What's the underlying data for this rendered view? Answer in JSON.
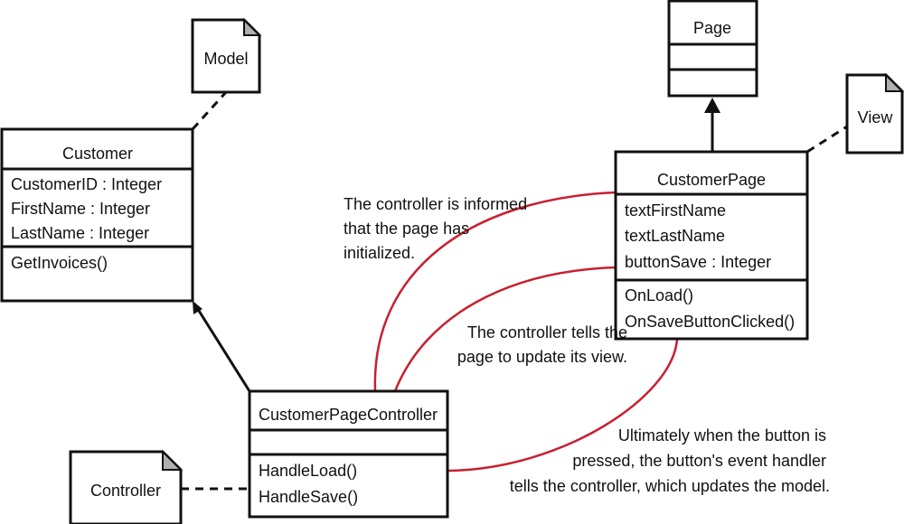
{
  "colors": {
    "association": "#c8202f",
    "note_fold": "#b0b0b0",
    "line": "#111111"
  },
  "notes": {
    "model": "Model",
    "view": "View",
    "controller": "Controller"
  },
  "classes": {
    "customer": {
      "name": "Customer",
      "attributes": [
        "CustomerID : Integer",
        "FirstName : Integer",
        "LastName : Integer"
      ],
      "methods": [
        "GetInvoices()"
      ]
    },
    "page": {
      "name": "Page",
      "attributes": [],
      "methods": []
    },
    "customer_page": {
      "name": "CustomerPage",
      "attributes": [
        "textFirstName",
        "textLastName",
        "buttonSave : Integer"
      ],
      "methods": [
        "OnLoad()",
        "OnSaveButtonClicked()"
      ]
    },
    "controller": {
      "name": "CustomerPageController",
      "attributes": [],
      "methods": [
        "HandleLoad()",
        "HandleSave()"
      ]
    }
  },
  "annotations": {
    "initialized": [
      "The controller is informed",
      "that the page has",
      "initialized."
    ],
    "update_view": [
      "The controller tells the",
      "page to update its view."
    ],
    "button_pressed": [
      "Ultimately when the button is",
      "pressed, the button's event handler",
      "tells the controller, which updates the model."
    ]
  }
}
